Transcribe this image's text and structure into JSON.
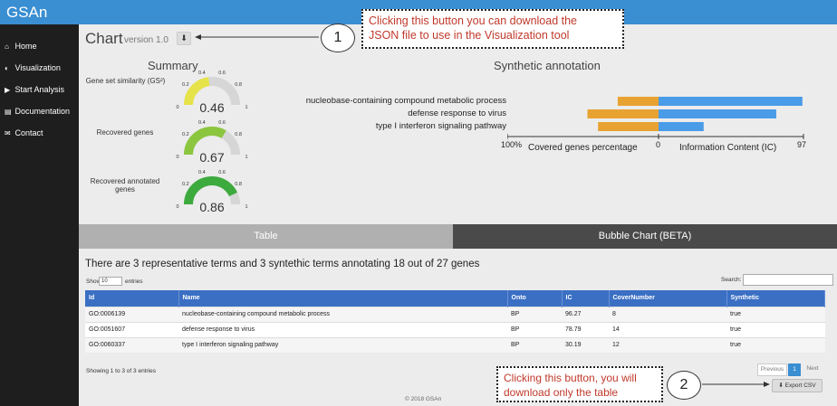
{
  "app": {
    "brand": "GSAn"
  },
  "sidebar": {
    "items": [
      {
        "icon": "⌂",
        "label": "Home"
      },
      {
        "icon": "◐",
        "label": "Visualization"
      },
      {
        "icon": "▶",
        "label": "Start Analysis"
      },
      {
        "icon": "▤",
        "label": "Documentation"
      },
      {
        "icon": "✉",
        "label": "Contact"
      }
    ]
  },
  "header": {
    "title": "Chart",
    "version": "version 1.0",
    "download_icon": "⬇"
  },
  "callouts": {
    "one_number": "1",
    "one_text_line1": "Clicking this button you can download the",
    "one_text_line2": "JSON file to use in the Visualization tool",
    "two_number": "2",
    "two_text_line1": "Clicking this button, you will",
    "two_text_line2": "download only the table"
  },
  "summary": {
    "title": "Summary",
    "gauges": [
      {
        "label": "Gene set similarity (GS²)",
        "value": 0.46,
        "display": "0.46",
        "color": "#e6e34a"
      },
      {
        "label": "Recovered genes",
        "value": 0.67,
        "display": "0.67",
        "color": "#8cc63f"
      },
      {
        "label": "Recovered annotated genes",
        "value": 0.86,
        "display": "0.86",
        "color": "#3daa3d"
      }
    ],
    "ticks": {
      "t0": "0",
      "t02": "0.2",
      "t04": "0.4",
      "t06": "0.6",
      "t08": "0.8",
      "t1": "1"
    }
  },
  "chart_data": {
    "type": "bar",
    "title": "Synthetic annotation",
    "categories": [
      "nucleobase-containing compound metabolic process",
      "defense response to virus",
      "type I interferon signaling pathway"
    ],
    "series": [
      {
        "name": "Covered genes percentage",
        "values": [
          27,
          47,
          40
        ],
        "color": "#e8a232"
      },
      {
        "name": "Information Content (IC)",
        "values": [
          96.27,
          78.79,
          30.19
        ],
        "color": "#4a9be8"
      }
    ],
    "left_axis": {
      "label": "Covered genes percentage",
      "min_label": "100%",
      "range": [
        0,
        100
      ]
    },
    "right_axis": {
      "label": "Information Content (IC)",
      "zero_label": "0",
      "max_label": "97",
      "range": [
        0,
        97
      ]
    }
  },
  "tabs": [
    {
      "label": "Table",
      "active": false
    },
    {
      "label": "Bubble Chart (BETA)",
      "active": true
    }
  ],
  "table": {
    "summary": "There are 3 representative terms and 3 syntethic terms annotating 18 out of 27 genes",
    "show_label": "Show",
    "show_value": "10",
    "entries_label": "entries",
    "search_label": "Search:",
    "columns": [
      "Id",
      "Name",
      "Onto",
      "IC",
      "CoverNumber",
      "Synthetic"
    ],
    "rows": [
      [
        "GO:0006139",
        "nucleobase-containing compound metabolic process",
        "BP",
        "96.27",
        "8",
        "true"
      ],
      [
        "GO:0051607",
        "defense response to virus",
        "BP",
        "78.79",
        "14",
        "true"
      ],
      [
        "GO:0060337",
        "type I interferon signaling pathway",
        "BP",
        "30.19",
        "12",
        "true"
      ]
    ],
    "info": "Showing 1 to 3 of 3 entries",
    "pagination": {
      "previous": "Previous",
      "current": "1",
      "next": "Next"
    },
    "export_label": "⬇ Export CSV"
  },
  "footer": {
    "text": "© 2018 GSAn"
  }
}
